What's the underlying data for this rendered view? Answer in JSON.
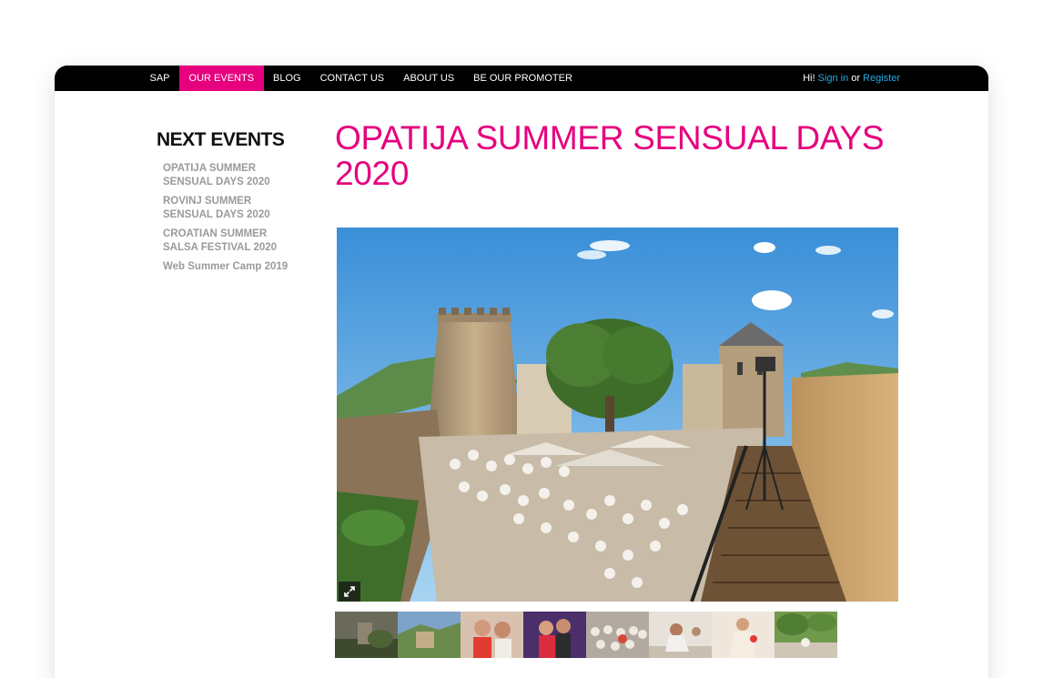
{
  "nav": {
    "items": [
      {
        "label": "SAP",
        "active": false
      },
      {
        "label": "OUR EVENTS",
        "active": true
      },
      {
        "label": "BLOG",
        "active": false
      },
      {
        "label": "CONTACT US",
        "active": false
      },
      {
        "label": "ABOUT US",
        "active": false
      },
      {
        "label": "BE OUR PROMOTER",
        "active": false
      }
    ],
    "auth": {
      "greeting": "Hi!",
      "sign_in": "Sign in",
      "or": "or",
      "register": "Register"
    }
  },
  "sidebar": {
    "heading": "NEXT EVENTS",
    "events": [
      "OPATIJA SUMMER SENSUAL DAYS 2020",
      "ROVINJ SUMMER SENSUAL DAYS 2020",
      "CROATIAN SUMMER SALSA FESTIVAL 2020",
      "Web Summer Camp 2019"
    ]
  },
  "event": {
    "title": "OPATIJA SUMMER SENSUAL DAYS 2020"
  },
  "gallery": {
    "expand_icon": "expand-icon",
    "thumbnail_count": 8
  },
  "colors": {
    "accent": "#e6007e",
    "link": "#27aae1",
    "navbar": "#000000",
    "sidebar_text": "#9a9a9a"
  }
}
